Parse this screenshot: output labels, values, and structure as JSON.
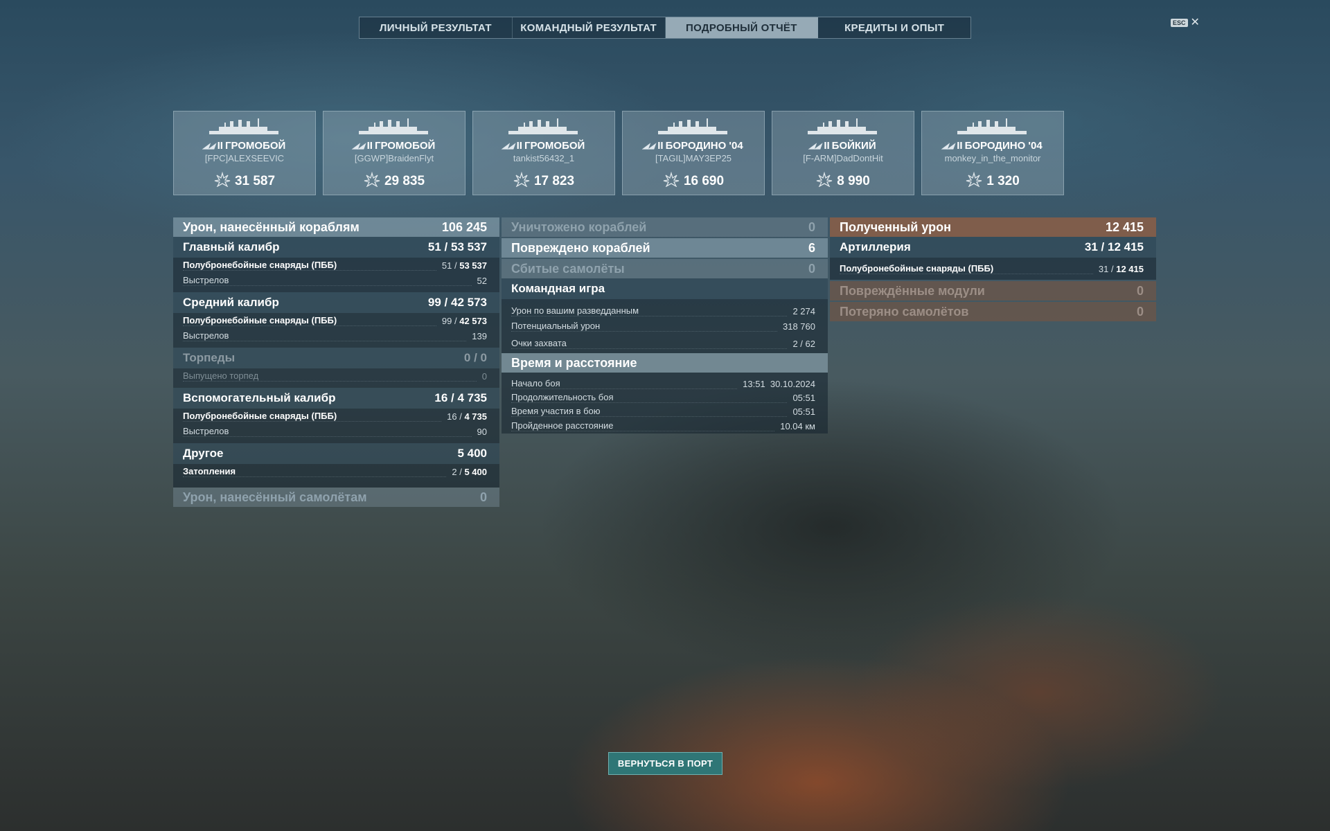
{
  "tabs": [
    "ЛИЧНЫЙ РЕЗУЛЬТАТ",
    "КОМАНДНЫЙ РЕЗУЛЬТАТ",
    "ПОДРОБНЫЙ ОТЧЁТ",
    "КРЕДИТЫ И ОПЫТ"
  ],
  "active_tab": 2,
  "esc_label": "ESC",
  "cards": [
    {
      "tier": "II",
      "ship": "ГРОМОБОЙ",
      "player": "[FPC]ALEXSEEVIC",
      "score": "31 587"
    },
    {
      "tier": "II",
      "ship": "ГРОМОБОЙ",
      "player": "[GGWP]BraidenFlyt",
      "score": "29 835"
    },
    {
      "tier": "II",
      "ship": "ГРОМОБОЙ",
      "player": "tankist56432_1",
      "score": "17 823"
    },
    {
      "tier": "II",
      "ship": "БОРОДИНО '04",
      "player": "[TAGIL]MAY3EP25",
      "score": "16 690"
    },
    {
      "tier": "II",
      "ship": "БОЙКИЙ",
      "player": "[F-ARM]DadDontHit",
      "score": "8 990"
    },
    {
      "tier": "II",
      "ship": "БОРОДИНО '04",
      "player": "monkey_in_the_monitor",
      "score": "1 320"
    }
  ],
  "left": {
    "damage": {
      "label": "Урон, нанесённый кораблям",
      "value": "106 245"
    },
    "main": {
      "label": "Главный калибр",
      "hits": "51",
      "dmg": "53 537"
    },
    "main_ap": {
      "label": "Полубронебойные снаряды (ПББ)",
      "hits": "51",
      "dmg": "53 537"
    },
    "main_shots": {
      "label": "Выстрелов",
      "value": "52"
    },
    "secondary": {
      "label": "Средний калибр",
      "hits": "99",
      "dmg": "42 573"
    },
    "secondary_ap": {
      "label": "Полубронебойные снаряды (ПББ)",
      "hits": "99",
      "dmg": "42 573"
    },
    "secondary_shots": {
      "label": "Выстрелов",
      "value": "139"
    },
    "torpedoes": {
      "label": "Торпеды",
      "hits": "0",
      "dmg": "0"
    },
    "torp_fired": {
      "label": "Выпущено торпед",
      "value": "0"
    },
    "aux": {
      "label": "Вспомогательный калибр",
      "hits": "16",
      "dmg": "4 735"
    },
    "aux_ap": {
      "label": "Полубронебойные снаряды (ПББ)",
      "hits": "16",
      "dmg": "4 735"
    },
    "aux_shots": {
      "label": "Выстрелов",
      "value": "90"
    },
    "other": {
      "label": "Другое",
      "value": "5 400"
    },
    "flooding": {
      "label": "Затопления",
      "hits": "2",
      "dmg": "5 400"
    },
    "planes_damage": {
      "label": "Урон, нанесённый самолётам",
      "value": "0"
    }
  },
  "middle": {
    "destroyed": {
      "label": "Уничтожено кораблей",
      "value": "0"
    },
    "damaged": {
      "label": "Повреждено кораблей",
      "value": "6"
    },
    "planes": {
      "label": "Сбитые самолёты",
      "value": "0"
    },
    "team": {
      "label": "Командная игра"
    },
    "spotting": {
      "label": "Урон по вашим разведданным",
      "value": "2 274"
    },
    "potential": {
      "label": "Потенциальный урон",
      "value": "318 760"
    },
    "capture": {
      "label": "Очки захвата",
      "value": "2 / 62"
    },
    "time": {
      "label": "Время и расстояние"
    },
    "start": {
      "label": "Начало боя",
      "value": "13:51  30.10.2024"
    },
    "duration": {
      "label": "Продолжительность боя",
      "value": "05:51"
    },
    "participation": {
      "label": "Время участия в бою",
      "value": "05:51"
    },
    "distance": {
      "label": "Пройденное расстояние",
      "value": "10.04 км"
    }
  },
  "right": {
    "received": {
      "label": "Полученный урон",
      "value": "12 415"
    },
    "artillery": {
      "label": "Артиллерия",
      "hits": "31",
      "dmg": "12 415"
    },
    "art_ap": {
      "label": "Полубронебойные снаряды (ПББ)",
      "hits": "31",
      "dmg": "12 415"
    },
    "modules": {
      "label": "Повреждённые модули",
      "value": "0"
    },
    "planes_lost": {
      "label": "Потеряно самолётов",
      "value": "0"
    }
  },
  "return_button": "ВЕРНУТЬСЯ В ПОРТ"
}
